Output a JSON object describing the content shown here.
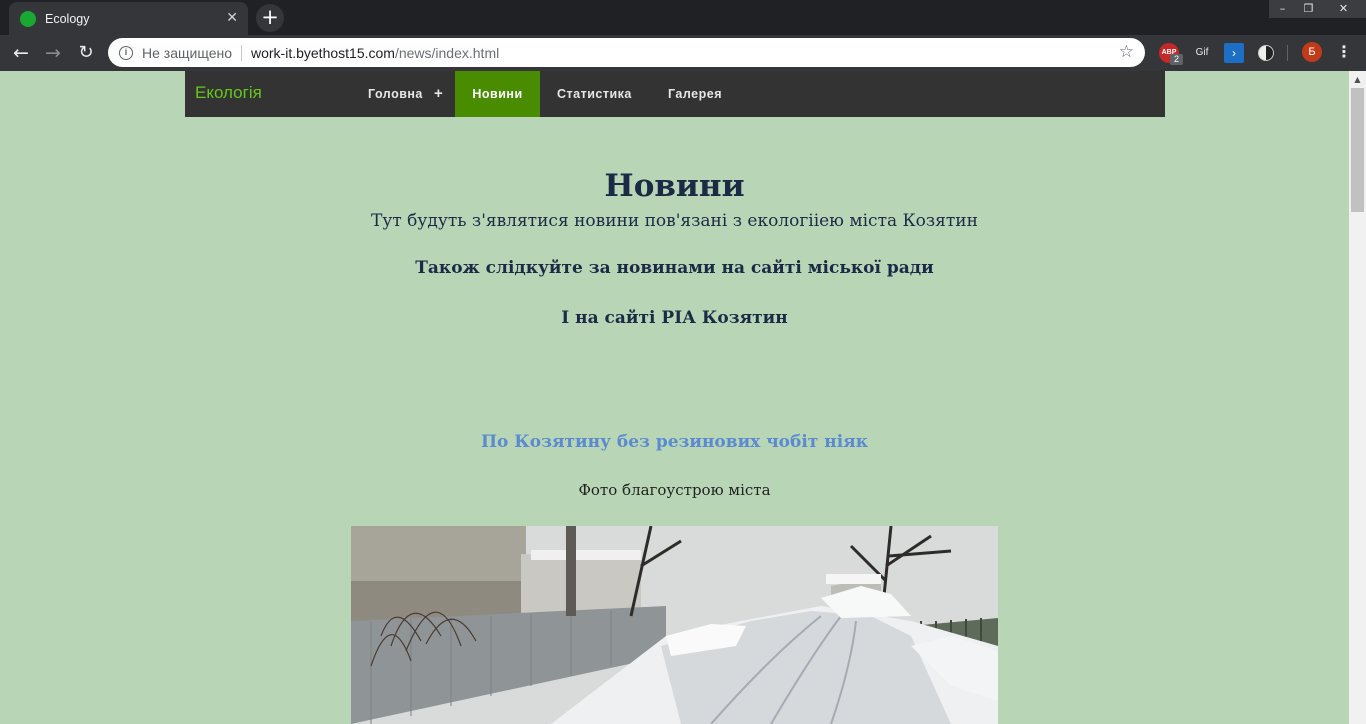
{
  "browser": {
    "tab_title": "Ecology",
    "tab_close": "✕",
    "new_tab": "+",
    "window_controls": {
      "minimize": "–",
      "maximize": "❐",
      "close": "✕"
    },
    "nav": {
      "back": "←",
      "forward": "→",
      "reload": "↻"
    },
    "address": {
      "security_text": "Не защищено",
      "url_host": "work-it.byethost15.com",
      "url_path": "/news/index.html"
    },
    "extensions": {
      "abp_label": "ABP",
      "abp_badge": "2",
      "gif_label": "Gif",
      "ps_label": "›"
    },
    "profile_initial": "Б",
    "menu": "⋮"
  },
  "site_nav": {
    "brand": "Екологія",
    "items": [
      {
        "label": "Головна",
        "has_submenu": true,
        "submenu_icon": "+"
      },
      {
        "label": "Новини",
        "active": true
      },
      {
        "label": "Статистика"
      },
      {
        "label": "Галерея"
      }
    ],
    "active_color": "#4a8c00",
    "brand_color": "#65c61c"
  },
  "main": {
    "title": "Новини",
    "subtitle": "Тут будуть з'являтися новини пов'язані з екологііею міста Козятин",
    "follow_city": "Також слідкуйте за новинами на сайті міської ради",
    "follow_ria": "І на сайті РІА Козятин",
    "article": {
      "title": "По Козятину без резинових чобіт ніяк",
      "caption": "Фото благоустрою міста",
      "image": "snowy-street-photo"
    }
  },
  "colors": {
    "page_background": "#b8d6b6",
    "heading": "#1b2a45",
    "article_link": "#5b8ad0"
  }
}
